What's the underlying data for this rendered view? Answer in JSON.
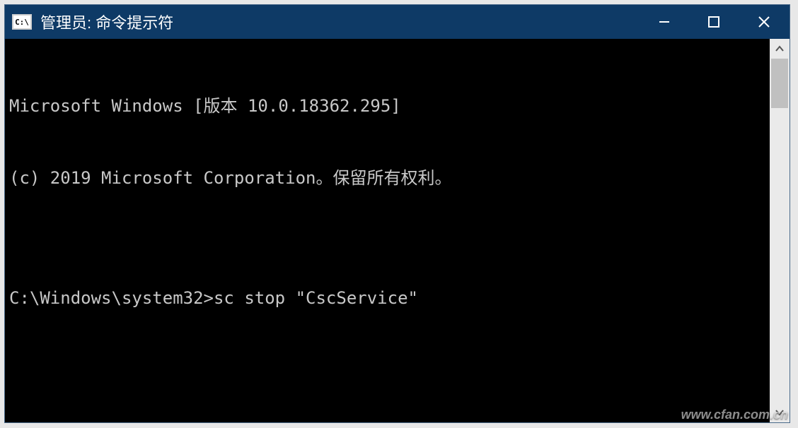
{
  "window": {
    "title": "管理员: 命令提示符",
    "icon_text": "C:\\"
  },
  "terminal": {
    "line1": "Microsoft Windows [版本 10.0.18362.295]",
    "line2": "(c) 2019 Microsoft Corporation。保留所有权利。",
    "blank": "",
    "prompt": "C:\\Windows\\system32>",
    "command": "sc stop \"CscService\""
  },
  "watermark": "www.cfan.com.cn"
}
